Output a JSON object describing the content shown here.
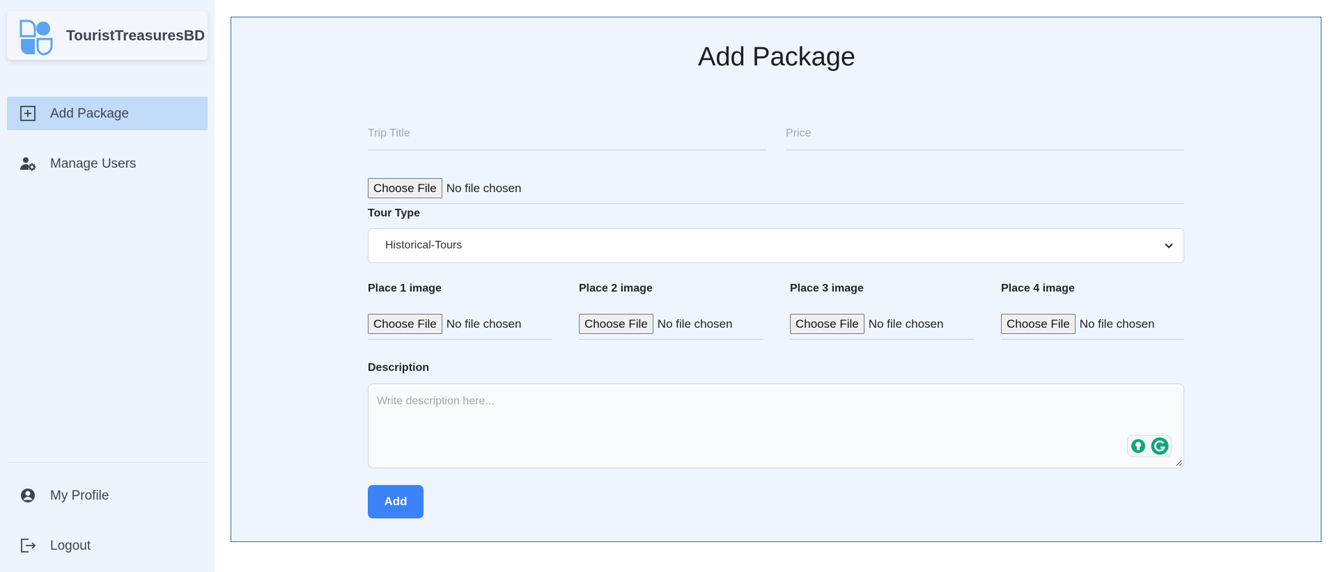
{
  "brand": {
    "name": "TouristTreasuresBD",
    "logo_icon": "shapes-logo-icon",
    "accent": "#5aa3f0"
  },
  "sidebar": {
    "top_items": [
      {
        "label": "Add Package",
        "icon": "plus-square-icon",
        "active": true
      },
      {
        "label": "Manage Users",
        "icon": "user-gear-icon",
        "active": false
      }
    ],
    "bottom_items": [
      {
        "label": "My Profile",
        "icon": "user-circle-icon"
      },
      {
        "label": "Logout",
        "icon": "logout-icon"
      }
    ],
    "active_color": "#c2dbf8",
    "background": "#eef4fd"
  },
  "form": {
    "title": "Add Package",
    "trip_title": {
      "placeholder": "Trip Title",
      "value": ""
    },
    "price": {
      "placeholder": "Price",
      "value": ""
    },
    "main_image": {
      "button": "Choose File",
      "status": "No file chosen"
    },
    "tour_type": {
      "label": "Tour Type",
      "selected": "Historical-Tours"
    },
    "place_images": [
      {
        "label": "Place 1 image",
        "button": "Choose File",
        "status": "No file chosen"
      },
      {
        "label": "Place 2 image",
        "button": "Choose File",
        "status": "No file chosen"
      },
      {
        "label": "Place 3 image",
        "button": "Choose File",
        "status": "No file chosen"
      },
      {
        "label": "Place 4 image",
        "button": "Choose File",
        "status": "No file chosen"
      }
    ],
    "description": {
      "label": "Description",
      "placeholder": "Write description here..."
    },
    "submit_label": "Add",
    "submit_color": "#3b82f6"
  }
}
